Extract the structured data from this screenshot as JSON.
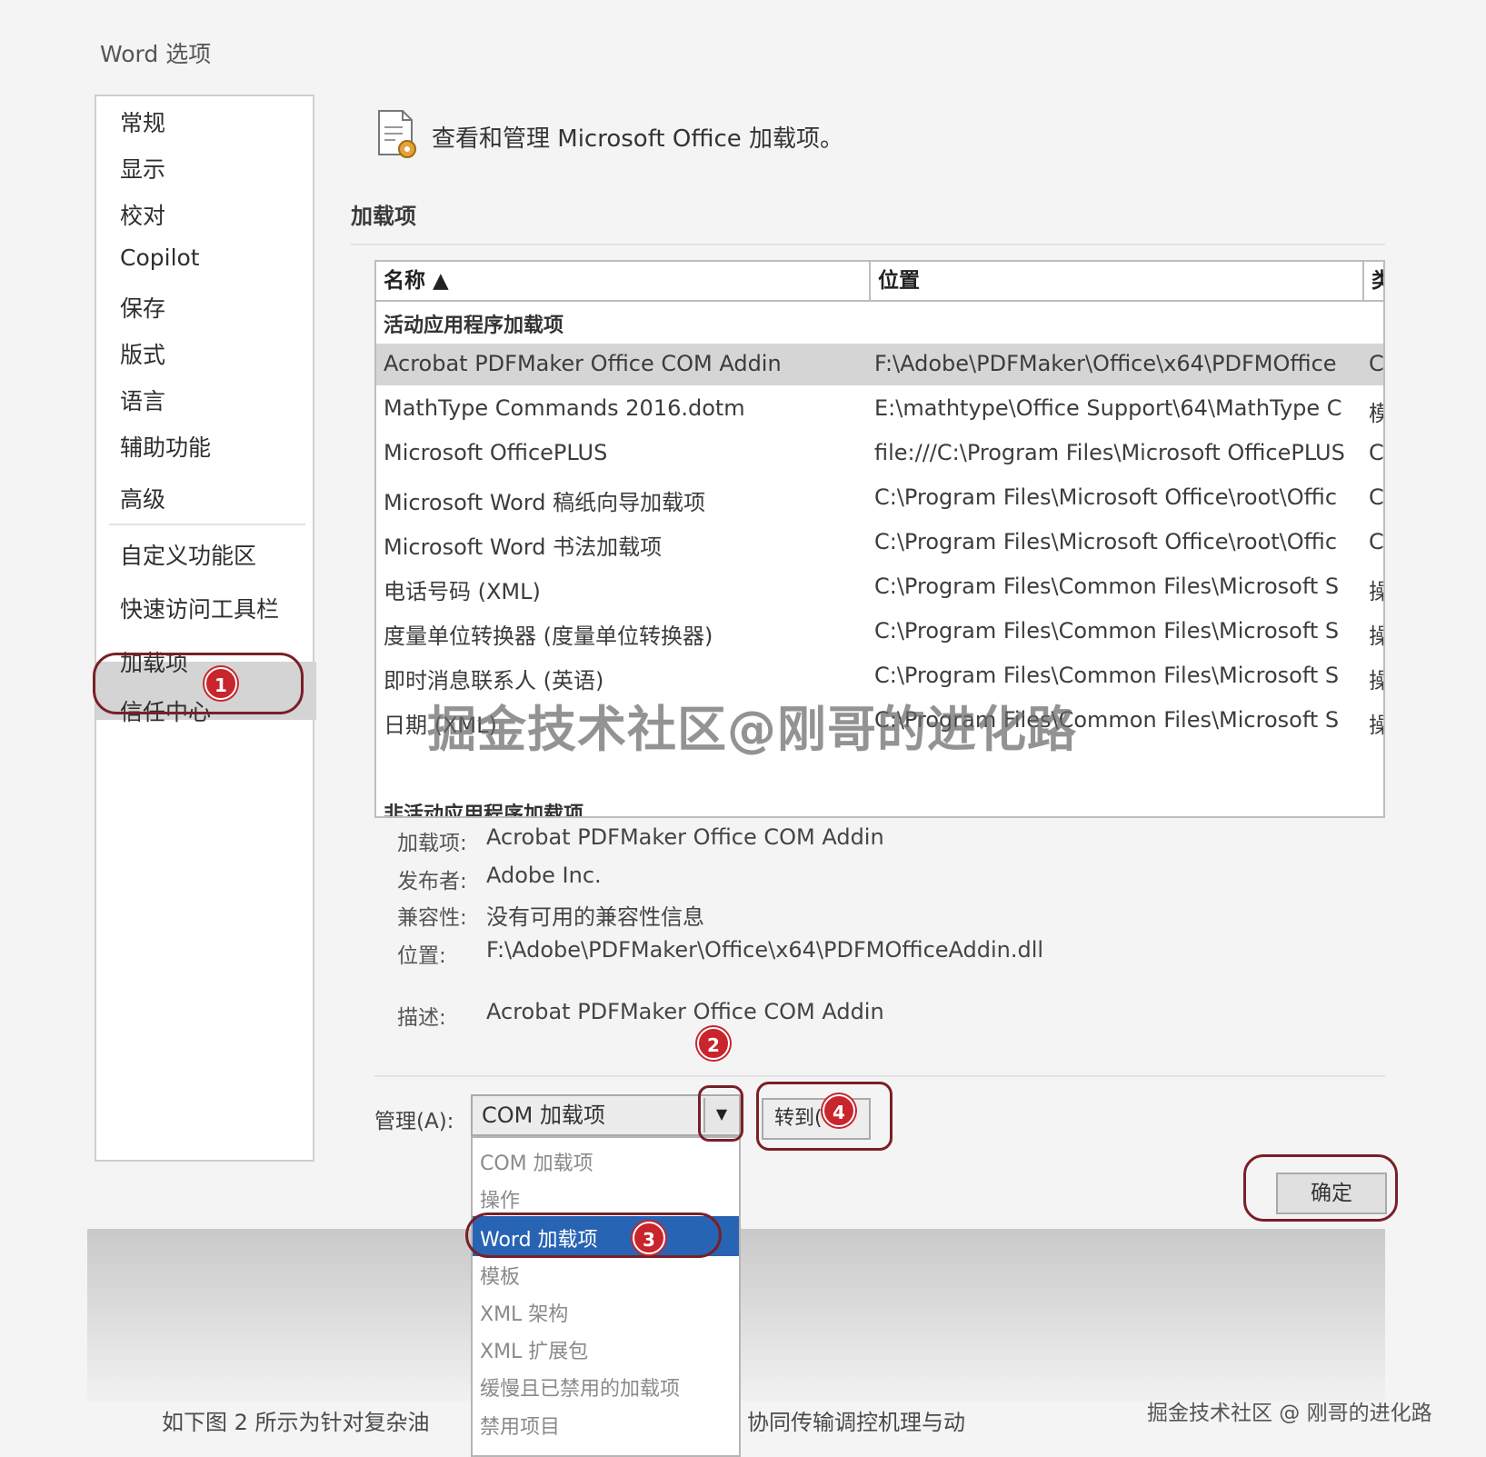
{
  "window": {
    "title": "Word 选项"
  },
  "sidebar": {
    "items": [
      {
        "label": "常规"
      },
      {
        "label": "显示"
      },
      {
        "label": "校对"
      },
      {
        "label": "Copilot"
      },
      {
        "label": "保存"
      },
      {
        "label": "版式"
      },
      {
        "label": "语言"
      },
      {
        "label": "辅助功能"
      },
      {
        "label": "高级"
      },
      {
        "label": "自定义功能区"
      },
      {
        "label": "快速访问工具栏"
      },
      {
        "label": "加载项",
        "active": true
      },
      {
        "label": "信任中心"
      }
    ]
  },
  "header": {
    "icon": "addins-gear-icon",
    "text": "查看和管理 Microsoft Office 加载项。"
  },
  "addins": {
    "section_title": "加载项",
    "columns": [
      "名称 ▲",
      "位置",
      "类"
    ],
    "active_group": "活动应用程序加载项",
    "inactive_group": "非活动应用程序加载项",
    "rows": [
      {
        "name": "Acrobat PDFMaker Office COM Addin",
        "location": "F:\\Adobe\\PDFMaker\\Office\\x64\\PDFMOffice",
        "type": "C",
        "selected": true
      },
      {
        "name": "MathType Commands 2016.dotm",
        "location": "E:\\mathtype\\Office Support\\64\\MathType C",
        "type": "模"
      },
      {
        "name": "Microsoft OfficePLUS",
        "location": "file:///C:\\Program Files\\Microsoft OfficePLUS",
        "type": "C"
      },
      {
        "name": "Microsoft Word 稿纸向导加载项",
        "location": "C:\\Program Files\\Microsoft Office\\root\\Offic",
        "type": "C"
      },
      {
        "name": "Microsoft Word 书法加载项",
        "location": "C:\\Program Files\\Microsoft Office\\root\\Offic",
        "type": "C"
      },
      {
        "name": "电话号码 (XML)",
        "location": "C:\\Program Files\\Common Files\\Microsoft S",
        "type": "操"
      },
      {
        "name": "度量单位转换器 (度量单位转换器)",
        "location": "C:\\Program Files\\Common Files\\Microsoft S",
        "type": "操"
      },
      {
        "name": "即时消息联系人 (英语)",
        "location": "C:\\Program Files\\Common Files\\Microsoft S",
        "type": "操"
      },
      {
        "name": "日期 (XML)",
        "location": "C:\\Program Files\\Common Files\\Microsoft S",
        "type": "操"
      }
    ]
  },
  "details": {
    "addin_label": "加载项:",
    "addin_value": "Acrobat PDFMaker Office COM Addin",
    "publisher_label": "发布者:",
    "publisher_value": "Adobe Inc.",
    "compat_label": "兼容性:",
    "compat_value": "没有可用的兼容性信息",
    "location_label": "位置:",
    "location_value": "F:\\Adobe\\PDFMaker\\Office\\x64\\PDFMOfficeAddin.dll",
    "desc_label": "描述:",
    "desc_value": "Acrobat PDFMaker Office COM Addin"
  },
  "manage": {
    "label": "管理(A):",
    "selected": "COM 加载项",
    "goto_label": "转到(",
    "ok_label": "确定",
    "options": [
      "COM 加载项",
      "操作",
      "Word 加载项",
      "模板",
      "XML 架构",
      "XML 扩展包",
      "缓慢且已禁用的加载项",
      "禁用项目"
    ],
    "highlighted_option": "Word 加载项"
  },
  "annotations": {
    "step1": "1",
    "step2": "2",
    "step3": "3",
    "step4": "4"
  },
  "watermark": "掘金技术社区@刚哥的进化路",
  "caption_left": "如下图 2 所示为针对复杂油",
  "caption_right": "协同传输调控机理与动",
  "corner_watermark": "掘金技术社区 @ 刚哥的进化路",
  "colors": {
    "accent_red": "#c8252d",
    "selection_blue": "#2864b4",
    "row_selected": "#d5d5d5"
  }
}
